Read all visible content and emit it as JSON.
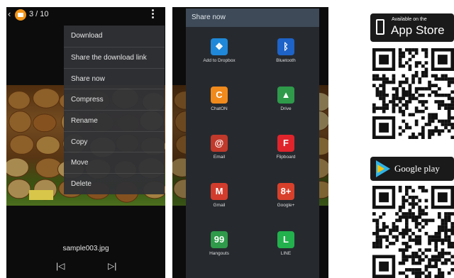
{
  "phone1": {
    "counter": "3 / 10",
    "menu_items": [
      "Download",
      "Share the download link",
      "Share now",
      "Compress",
      "Rename",
      "Copy",
      "Move",
      "Delete"
    ],
    "filename": "sample003.jpg",
    "icons": {
      "back": "chevron-left-icon",
      "badge": "app-badge-icon",
      "more": "more-vert-icon",
      "prev": "skip-previous-icon",
      "next": "skip-next-icon"
    }
  },
  "phone2": {
    "title": "Share now",
    "targets": [
      {
        "label": "Add to Dropbox",
        "icon": "dropbox-icon",
        "color": "#1f88d9",
        "glyph": "❖"
      },
      {
        "label": "Bluetooth",
        "icon": "bluetooth-icon",
        "color": "#1e63c7",
        "glyph": "ᛒ"
      },
      {
        "label": "ChatON",
        "icon": "chaton-icon",
        "color": "#f08a1c",
        "glyph": "C"
      },
      {
        "label": "Drive",
        "icon": "drive-icon",
        "color": "#2e9a4a",
        "glyph": "▲"
      },
      {
        "label": "Email",
        "icon": "email-icon",
        "color": "#c0392b",
        "glyph": "@"
      },
      {
        "label": "Flipboard",
        "icon": "flipboard-icon",
        "color": "#e0242c",
        "glyph": "F"
      },
      {
        "label": "Gmail",
        "icon": "gmail-icon",
        "color": "#d23c2c",
        "glyph": "M"
      },
      {
        "label": "Google+",
        "icon": "google-plus-icon",
        "color": "#d8402b",
        "glyph": "8+"
      },
      {
        "label": "Hangouts",
        "icon": "hangouts-icon",
        "color": "#2e9a4a",
        "glyph": "99"
      },
      {
        "label": "LINE",
        "icon": "line-icon",
        "color": "#22b14c",
        "glyph": "L"
      }
    ]
  },
  "stores": {
    "appstore_small": "Available on the",
    "appstore_big": "App Store",
    "googleplay": "Google play"
  }
}
